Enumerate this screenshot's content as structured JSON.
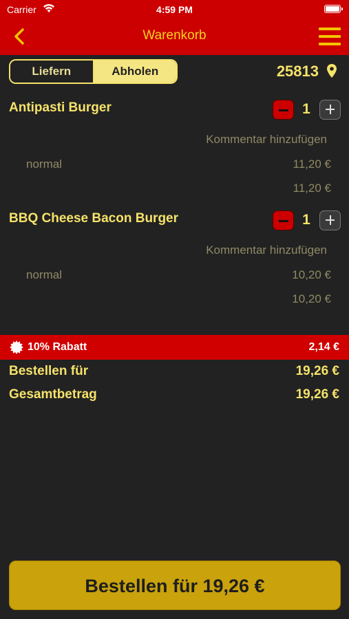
{
  "status_bar": {
    "carrier": "Carrier",
    "time": "4:59 PM"
  },
  "nav": {
    "title": "Warenkorb",
    "back_icon": "chevron-left-icon",
    "menu_icon": "hamburger-menu-icon"
  },
  "delivery_mode": {
    "options": [
      "Liefern",
      "Abholen"
    ],
    "selected": "Abholen"
  },
  "location": {
    "postcode": "25813"
  },
  "cart_items": [
    {
      "name": "Antipasti Burger",
      "quantity": "1",
      "comment_label": "Kommentar hinzufügen",
      "variant": "normal",
      "variant_price": "11,20 €",
      "total": "11,20 €"
    },
    {
      "name": "BBQ Cheese Bacon Burger",
      "quantity": "1",
      "comment_label": "Kommentar hinzufügen",
      "variant": "normal",
      "variant_price": "10,20 €",
      "total": "10,20 €"
    }
  ],
  "discount": {
    "label": "10% Rabatt",
    "amount": "2,14 €"
  },
  "summary": {
    "order_label": "Bestellen für",
    "order_value": "19,26 €",
    "total_label": "Gesamtbetrag",
    "total_value": "19,26 €"
  },
  "order_button": {
    "label": "Bestellen für 19,26 €"
  },
  "colors": {
    "brand_red": "#cc0000",
    "accent_yellow": "#f5e26a",
    "button_gold": "#c9a20c",
    "background": "#222222"
  }
}
